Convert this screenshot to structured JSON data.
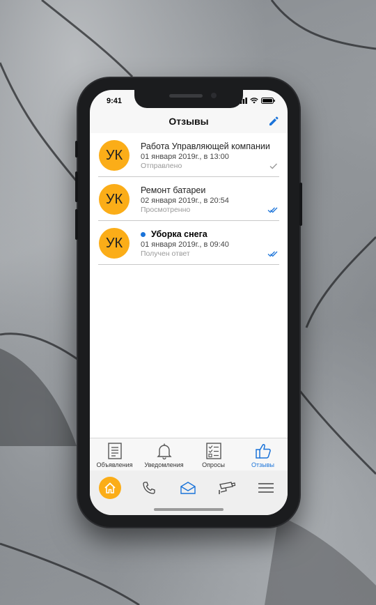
{
  "status": {
    "time": "9:41"
  },
  "header": {
    "title": "Отзывы",
    "edit_icon": "pencil-icon"
  },
  "reviews": [
    {
      "avatar": "УК",
      "title": "Работа Управляющей компании",
      "date": "01 января 2019г., в 13:00",
      "status": "Отправлено",
      "check": "single",
      "unread": false
    },
    {
      "avatar": "УК",
      "title": "Ремонт батареи",
      "date": "02 января 2019г., в 20:54",
      "status": "Просмотренно",
      "check": "double",
      "unread": false
    },
    {
      "avatar": "УК",
      "title": "Уборка снега",
      "date": "01 января 2019г., в 09:40",
      "status": "Получен ответ",
      "check": "double",
      "unread": true
    }
  ],
  "tabs": [
    {
      "label": "Объявления",
      "icon": "document-icon"
    },
    {
      "label": "Уведомления",
      "icon": "bell-icon"
    },
    {
      "label": "Опросы",
      "icon": "checklist-icon"
    },
    {
      "label": "Отзывы",
      "icon": "thumbs-up-icon",
      "active": true
    }
  ],
  "bottom_nav": [
    "home-icon",
    "phone-icon",
    "mail-icon",
    "cctv-camera-icon",
    "menu-icon"
  ],
  "colors": {
    "accent": "#1a73d9",
    "avatar": "#fbad18",
    "home": "#fbad18"
  }
}
